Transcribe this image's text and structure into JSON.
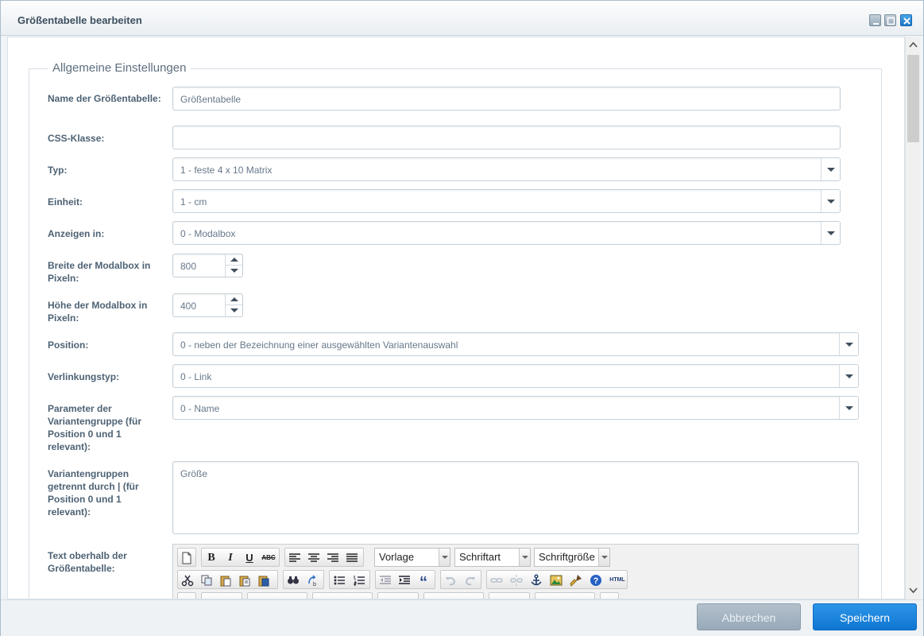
{
  "window": {
    "title": "Größentabelle bearbeiten"
  },
  "section": {
    "legend": "Allgemeine Einstellungen"
  },
  "fields": {
    "name": {
      "label": "Name der Größentabelle:",
      "value": "Größentabelle"
    },
    "css": {
      "label": "CSS-Klasse:",
      "value": ""
    },
    "typ": {
      "label": "Typ:",
      "value": "1 - feste 4 x 10 Matrix"
    },
    "einheit": {
      "label": "Einheit:",
      "value": "1 - cm"
    },
    "anzeigen": {
      "label": "Anzeigen in:",
      "value": "0 - Modalbox"
    },
    "breite": {
      "label": "Breite der Modalbox in Pixeln:",
      "value": "800"
    },
    "hoehe": {
      "label": "Höhe der Modalbox in Pixeln:",
      "value": "400"
    },
    "position": {
      "label": "Position:",
      "value": "0 - neben der Bezeichnung einer ausgewählten Variantenauswahl"
    },
    "verlinkung": {
      "label": "Verlinkungstyp:",
      "value": "0 - Link"
    },
    "parameter": {
      "label": "Parameter der Variantengruppe (für Position 0 und 1 relevant):",
      "value": "0 - Name"
    },
    "variantengruppen": {
      "label": "Variantengruppen getrennt durch | (für Position 0 und 1 relevant):",
      "value": "Größe"
    },
    "text_oberhalb": {
      "label": "Text oberhalb der Größentabelle:"
    }
  },
  "editor": {
    "format_select": "Vorlage",
    "font_select": "Schriftart",
    "size_select": "Schriftgröße",
    "buttons": [
      "new-document",
      "bold",
      "italic",
      "underline",
      "strikethrough",
      "align-left",
      "align-center",
      "align-right",
      "justify",
      "cut",
      "copy",
      "paste",
      "paste-text",
      "paste-word",
      "find",
      "replace",
      "bullet-list",
      "numbered-list",
      "outdent",
      "indent",
      "blockquote",
      "undo",
      "redo",
      "link",
      "unlink",
      "anchor",
      "image",
      "cleanup",
      "help",
      "html"
    ],
    "labels": {
      "bold": "B",
      "italic": "I",
      "underline": "U",
      "strike": "ABC",
      "quote": "“",
      "help": "?",
      "html": "HTML"
    }
  },
  "footer": {
    "cancel_label": "Abbrechen",
    "save_label": "Speichern"
  },
  "colors": {
    "primary": "#1a85dd",
    "secondary": "#a6b5c3",
    "label": "#4d6274"
  }
}
